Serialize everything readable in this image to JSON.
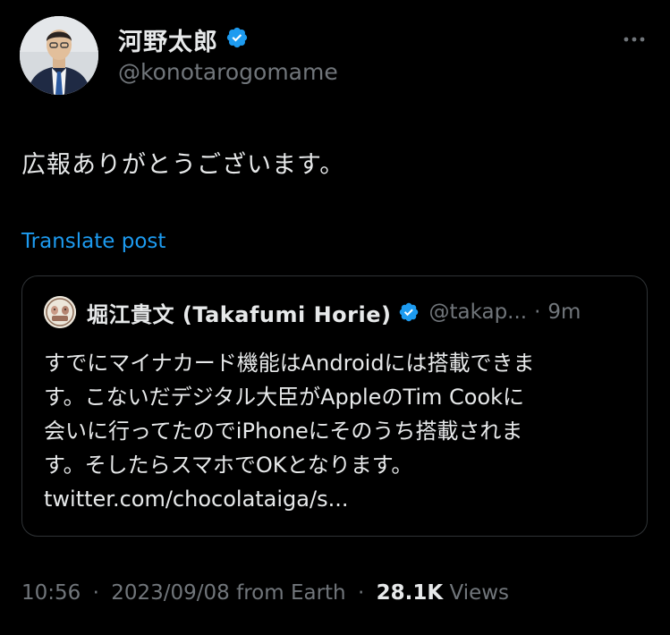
{
  "author": {
    "display_name": "河野太郎",
    "handle": "@konotarogomame",
    "verified": true
  },
  "tweet": {
    "text": "広報ありがとうございます。",
    "translate_label": "Translate post"
  },
  "quoted": {
    "display_name": "堀江貴文 (Takafumi Horie)",
    "handle": "@takap...",
    "separator": "·",
    "time_ago": "9m",
    "verified": true,
    "lines": [
      "すでにマイナカード機能はAndroidには搭載できま",
      "す。こないだデジタル大臣がAppleのTim Cookに",
      "会いに行ってたのでiPhoneにそのうち搭載されま",
      "す。そしたらスマホでOKとなります。"
    ],
    "link": "twitter.com/chocolataiga/s..."
  },
  "meta": {
    "time": "10:56",
    "sep1": "·",
    "date": "2023/09/08",
    "source": "from Earth",
    "sep2": "·",
    "views_count": "28.1K",
    "views_label": "Views"
  },
  "colors": {
    "background": "#000000",
    "text": "#e7e9ea",
    "secondary": "#71767b",
    "link": "#1d9bf0",
    "verified": "#1d9bf0",
    "border": "#2f3336"
  },
  "icons": {
    "verified": "verified-badge-icon",
    "more": "more-horizontal-icon"
  }
}
